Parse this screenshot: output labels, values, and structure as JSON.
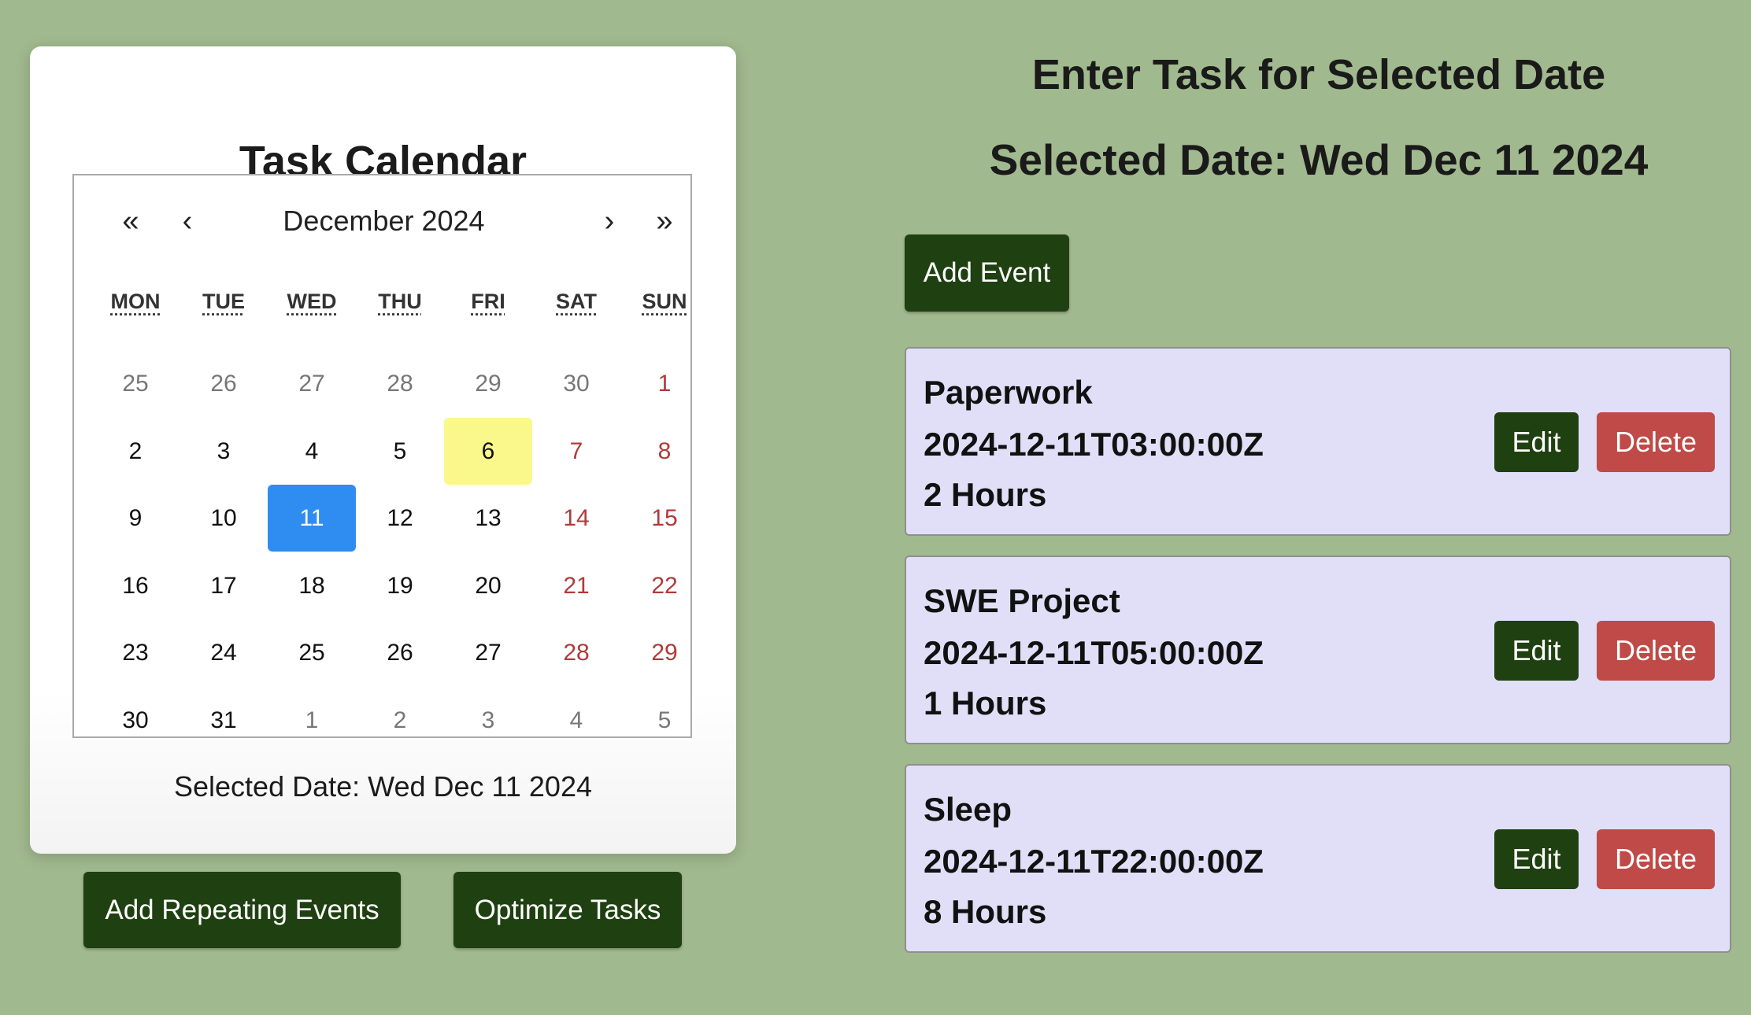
{
  "calendar_card": {
    "title": "Task Calendar",
    "nav": {
      "prev_year": "«",
      "prev_month": "‹",
      "month_label": "December 2024",
      "next_month": "›",
      "next_year": "»"
    },
    "weekdays": [
      "MON",
      "TUE",
      "WED",
      "THU",
      "FRI",
      "SAT",
      "SUN"
    ],
    "weeks": [
      [
        {
          "d": "25",
          "t": "other"
        },
        {
          "d": "26",
          "t": "other"
        },
        {
          "d": "27",
          "t": "other"
        },
        {
          "d": "28",
          "t": "other"
        },
        {
          "d": "29",
          "t": "other"
        },
        {
          "d": "30",
          "t": "other"
        },
        {
          "d": "1",
          "t": "weekend"
        }
      ],
      [
        {
          "d": "2",
          "t": ""
        },
        {
          "d": "3",
          "t": ""
        },
        {
          "d": "4",
          "t": ""
        },
        {
          "d": "5",
          "t": ""
        },
        {
          "d": "6",
          "t": "today"
        },
        {
          "d": "7",
          "t": "weekend"
        },
        {
          "d": "8",
          "t": "weekend"
        }
      ],
      [
        {
          "d": "9",
          "t": ""
        },
        {
          "d": "10",
          "t": ""
        },
        {
          "d": "11",
          "t": "selected"
        },
        {
          "d": "12",
          "t": ""
        },
        {
          "d": "13",
          "t": ""
        },
        {
          "d": "14",
          "t": "weekend"
        },
        {
          "d": "15",
          "t": "weekend"
        }
      ],
      [
        {
          "d": "16",
          "t": ""
        },
        {
          "d": "17",
          "t": ""
        },
        {
          "d": "18",
          "t": ""
        },
        {
          "d": "19",
          "t": ""
        },
        {
          "d": "20",
          "t": ""
        },
        {
          "d": "21",
          "t": "weekend"
        },
        {
          "d": "22",
          "t": "weekend"
        }
      ],
      [
        {
          "d": "23",
          "t": ""
        },
        {
          "d": "24",
          "t": ""
        },
        {
          "d": "25",
          "t": ""
        },
        {
          "d": "26",
          "t": ""
        },
        {
          "d": "27",
          "t": ""
        },
        {
          "d": "28",
          "t": "weekend"
        },
        {
          "d": "29",
          "t": "weekend"
        }
      ],
      [
        {
          "d": "30",
          "t": ""
        },
        {
          "d": "31",
          "t": ""
        },
        {
          "d": "1",
          "t": "other"
        },
        {
          "d": "2",
          "t": "other"
        },
        {
          "d": "3",
          "t": "other"
        },
        {
          "d": "4",
          "t": "other"
        },
        {
          "d": "5",
          "t": "other"
        }
      ]
    ],
    "selected_date_text": "Selected Date: Wed Dec 11 2024"
  },
  "buttons": {
    "add_repeating": "Add Repeating Events",
    "optimize": "Optimize Tasks",
    "add_event": "Add Event"
  },
  "right_panel": {
    "heading": "Enter Task for Selected Date",
    "selected_date": "Selected Date: Wed Dec 11 2024"
  },
  "tasks": [
    {
      "name": "Paperwork",
      "datetime": "2024-12-11T03:00:00Z",
      "duration": "2 Hours",
      "edit": "Edit",
      "delete": "Delete"
    },
    {
      "name": "SWE Project",
      "datetime": "2024-12-11T05:00:00Z",
      "duration": "1 Hours",
      "edit": "Edit",
      "delete": "Delete"
    },
    {
      "name": "Sleep",
      "datetime": "2024-12-11T22:00:00Z",
      "duration": "8 Hours",
      "edit": "Edit",
      "delete": "Delete"
    }
  ],
  "colors": {
    "background": "#a1b98e",
    "button_green": "#1f4010",
    "delete_red": "#bf4a47",
    "selected_blue": "#2f8df2",
    "today_yellow": "#faf88a",
    "weekend_red": "#b03a3a",
    "task_card": "#e1dff8"
  }
}
